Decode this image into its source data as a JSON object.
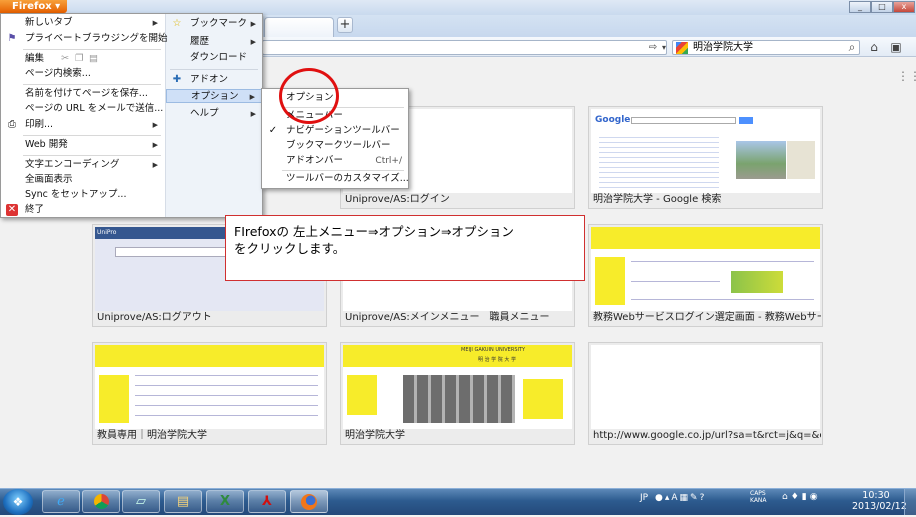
{
  "window": {
    "app_button": "Firefox",
    "minimize": "_",
    "maximize": "□",
    "close": "x"
  },
  "tabs": {
    "new_tab": "+"
  },
  "navbar": {
    "url_value": "",
    "search_engine_icon": "google-icon",
    "search_value": "明治学院大学"
  },
  "app_menu": {
    "left": [
      {
        "label": "新しいタブ",
        "arrow": "▶"
      },
      {
        "label": "プライベートブラウジングを開始"
      },
      {
        "label": "編集"
      },
      {
        "label": "ページ内検索..."
      },
      {
        "label": "名前を付けてページを保存..."
      },
      {
        "label": "ページの URL をメールで送信..."
      },
      {
        "label": "印刷...",
        "arrow": "▶"
      },
      {
        "label": "Web 開発",
        "arrow": "▶"
      },
      {
        "label": "文字エンコーディング",
        "arrow": "▶"
      },
      {
        "label": "全画面表示"
      },
      {
        "label": "Sync をセットアップ..."
      },
      {
        "label": "終了"
      }
    ],
    "right": [
      {
        "label": "ブックマーク",
        "arrow": "▶"
      },
      {
        "label": "履歴",
        "arrow": "▶"
      },
      {
        "label": "ダウンロード"
      },
      {
        "label": "アドオン"
      },
      {
        "label": "オプション",
        "arrow": "▶"
      },
      {
        "label": "ヘルプ",
        "arrow": "▶"
      }
    ]
  },
  "options_submenu": {
    "items": [
      {
        "label": "オプション"
      },
      {
        "label": "メニューバー"
      },
      {
        "label": "ナビゲーションツールバー",
        "check": "✓"
      },
      {
        "label": "ブックマークツールバー"
      },
      {
        "label": "アドオンバー",
        "shortcut": "Ctrl+/"
      },
      {
        "label": "ツールバーのカスタマイズ..."
      }
    ]
  },
  "callout": {
    "line1": "FIrefoxの 左上メニュー⇒オプション⇒オプション",
    "line2": "をクリックします。"
  },
  "thumbnails": [
    {
      "caption": "Uniprove/AS:ログイン"
    },
    {
      "caption": "明治学院大学 - Google 検索"
    },
    {
      "caption": "Uniprove/AS:ログアウト"
    },
    {
      "caption": "Uniprove/AS:メインメニュー　職員メニュー"
    },
    {
      "caption": "教務Webサービスログイン選定画面 - 教務Webサービスロ…"
    },
    {
      "caption": "教員専用｜明治学院大学"
    },
    {
      "caption": "明治学院大学"
    },
    {
      "caption": "http://www.google.co.jp/url?sa=t&rct=j&q=&esrc=s…"
    }
  ],
  "thumb_text": {
    "google_logo": "Google",
    "uniprove": "UniPro",
    "meiji_univ": "MEIJI GAKUIN UNIVERSITY",
    "meiji_jp": "明 治 学 院 大 学"
  },
  "taskbar": {
    "lang": "JP",
    "caps": "CAPS",
    "kana": "KANA",
    "time": "10:30",
    "date": "2013/02/12"
  },
  "colors": {
    "firefox_orange": "#e66000",
    "callout_border": "#d03030",
    "circle": "#e01010",
    "meiji_yellow": "#f7ec2a"
  }
}
